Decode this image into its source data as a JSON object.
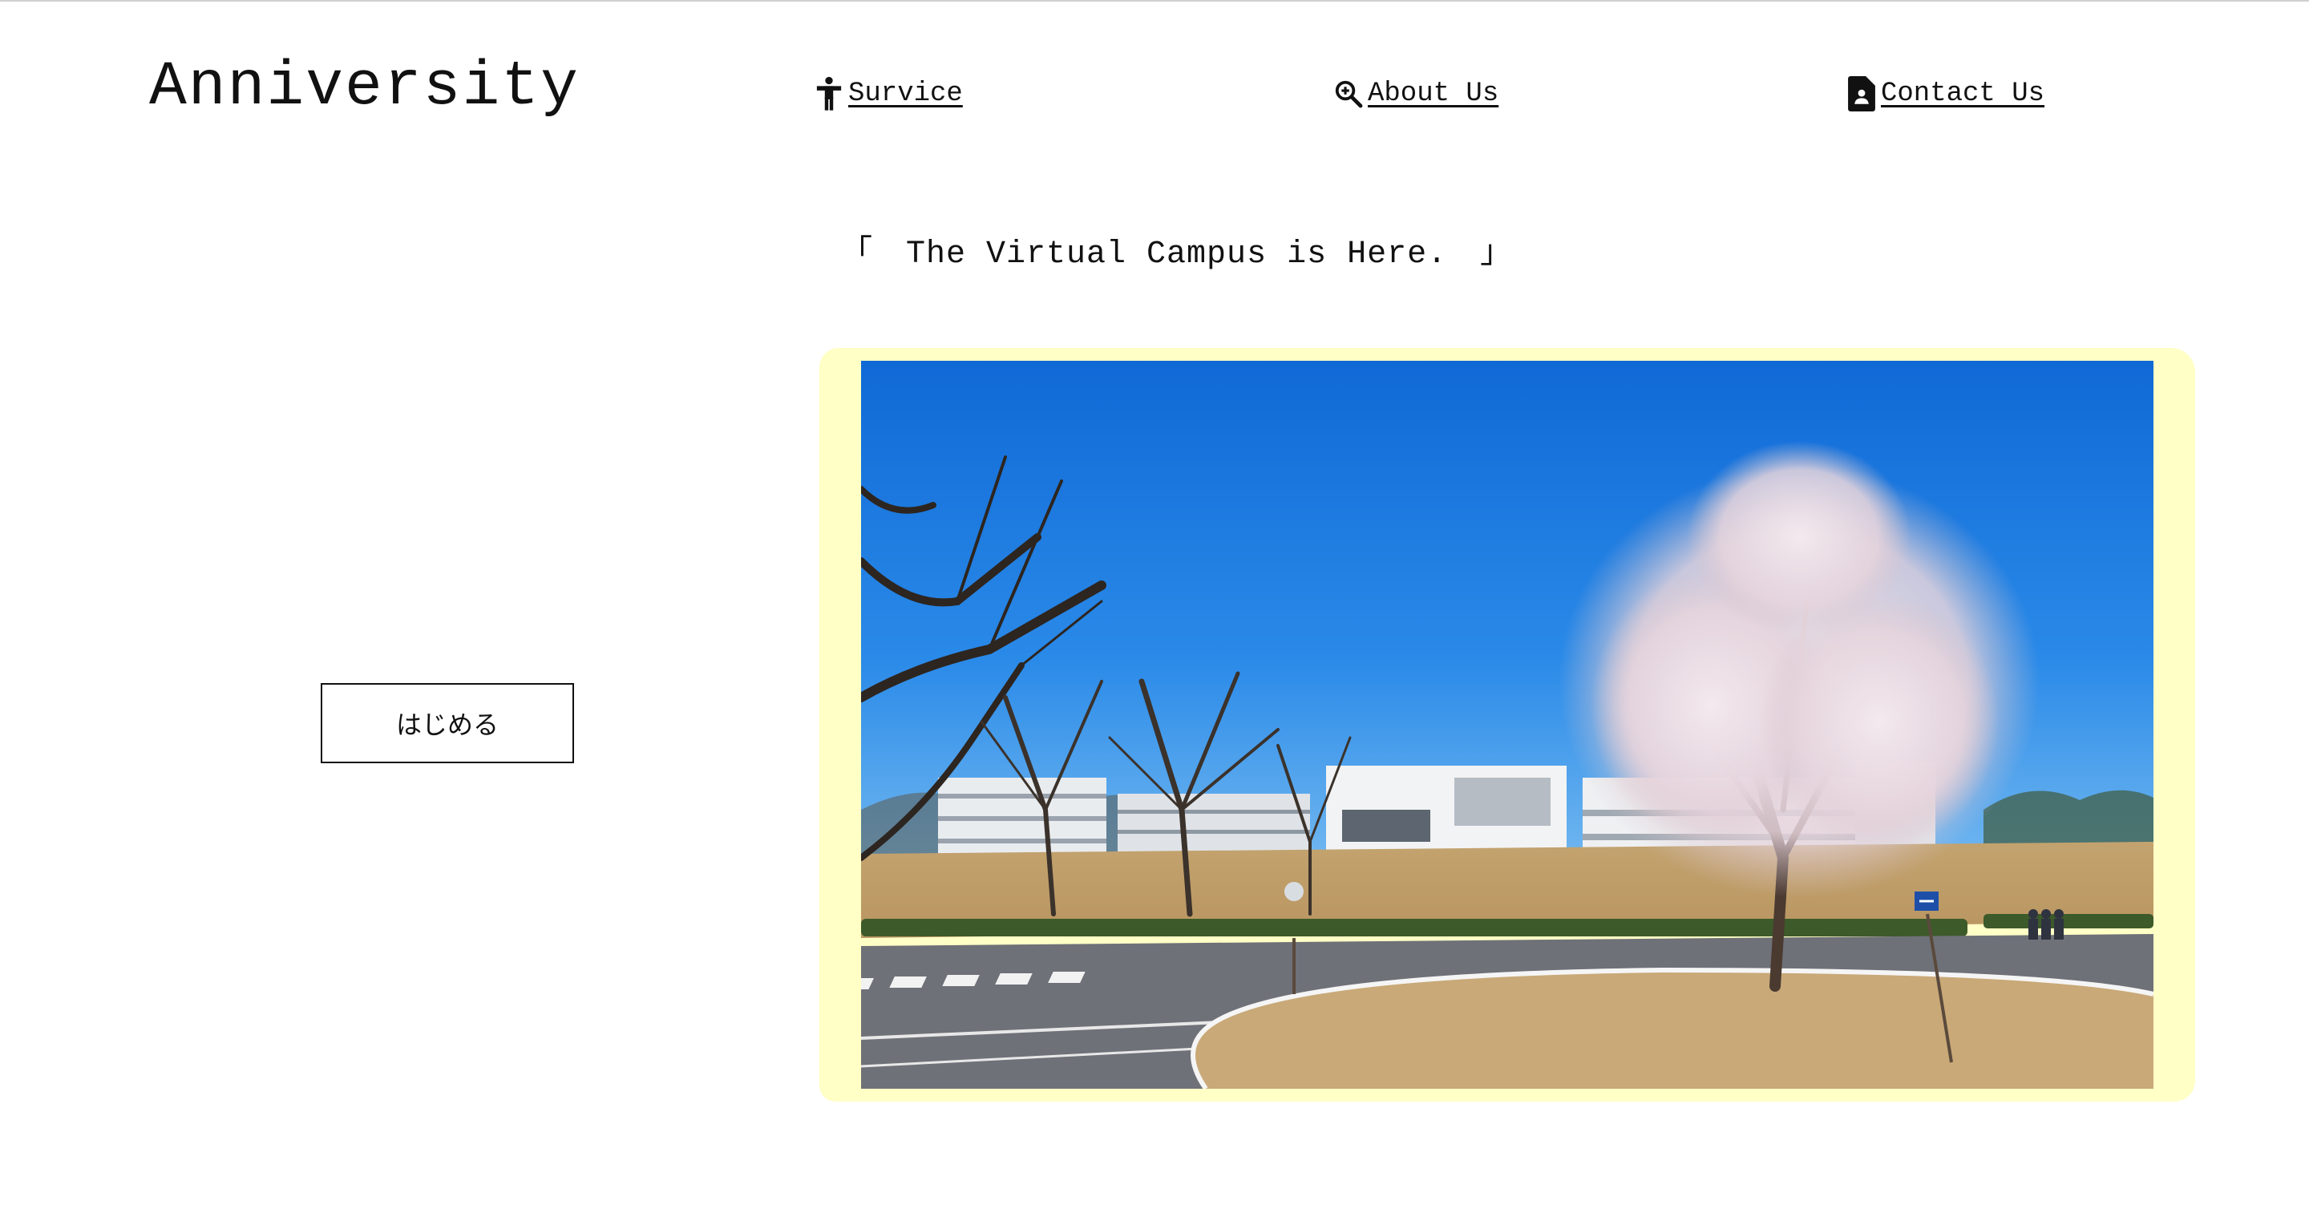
{
  "header": {
    "logo": "Anniversity",
    "nav": [
      {
        "label": "Survice",
        "icon": "accessibility-person-icon"
      },
      {
        "label": "About Us",
        "icon": "zoom-in-icon"
      },
      {
        "label": "Contact Us",
        "icon": "contact-document-icon"
      }
    ]
  },
  "hero": {
    "tagline": "「　The Virtual Campus is Here.　」",
    "start_button_label": "はじめる",
    "photo": {
      "subject": "campus-photo",
      "colors": {
        "frame": "#ffffc6",
        "sky": "#1a78e0",
        "lawn": "#c9a978",
        "road": "#6f7178"
      }
    }
  }
}
